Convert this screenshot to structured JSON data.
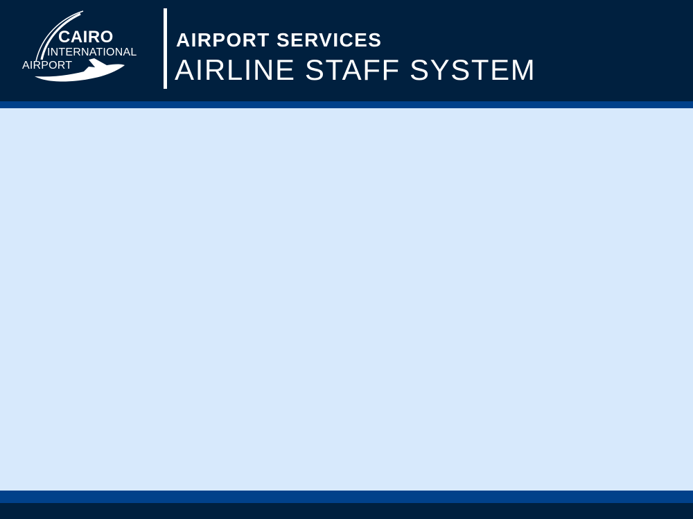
{
  "header": {
    "logo": {
      "line1": "CAIRO",
      "line2": "INTERNATIONAL",
      "line3": "AIRPORT",
      "icon": "airplane-swoosh-icon"
    },
    "title": "AIRPORT SERVICES",
    "subtitle": "AIRLINE STAFF SYSTEM"
  },
  "colors": {
    "header_bg": "#00203f",
    "stripe": "#01418a",
    "content_bg": "#d7e9fc",
    "text": "#ffffff"
  }
}
